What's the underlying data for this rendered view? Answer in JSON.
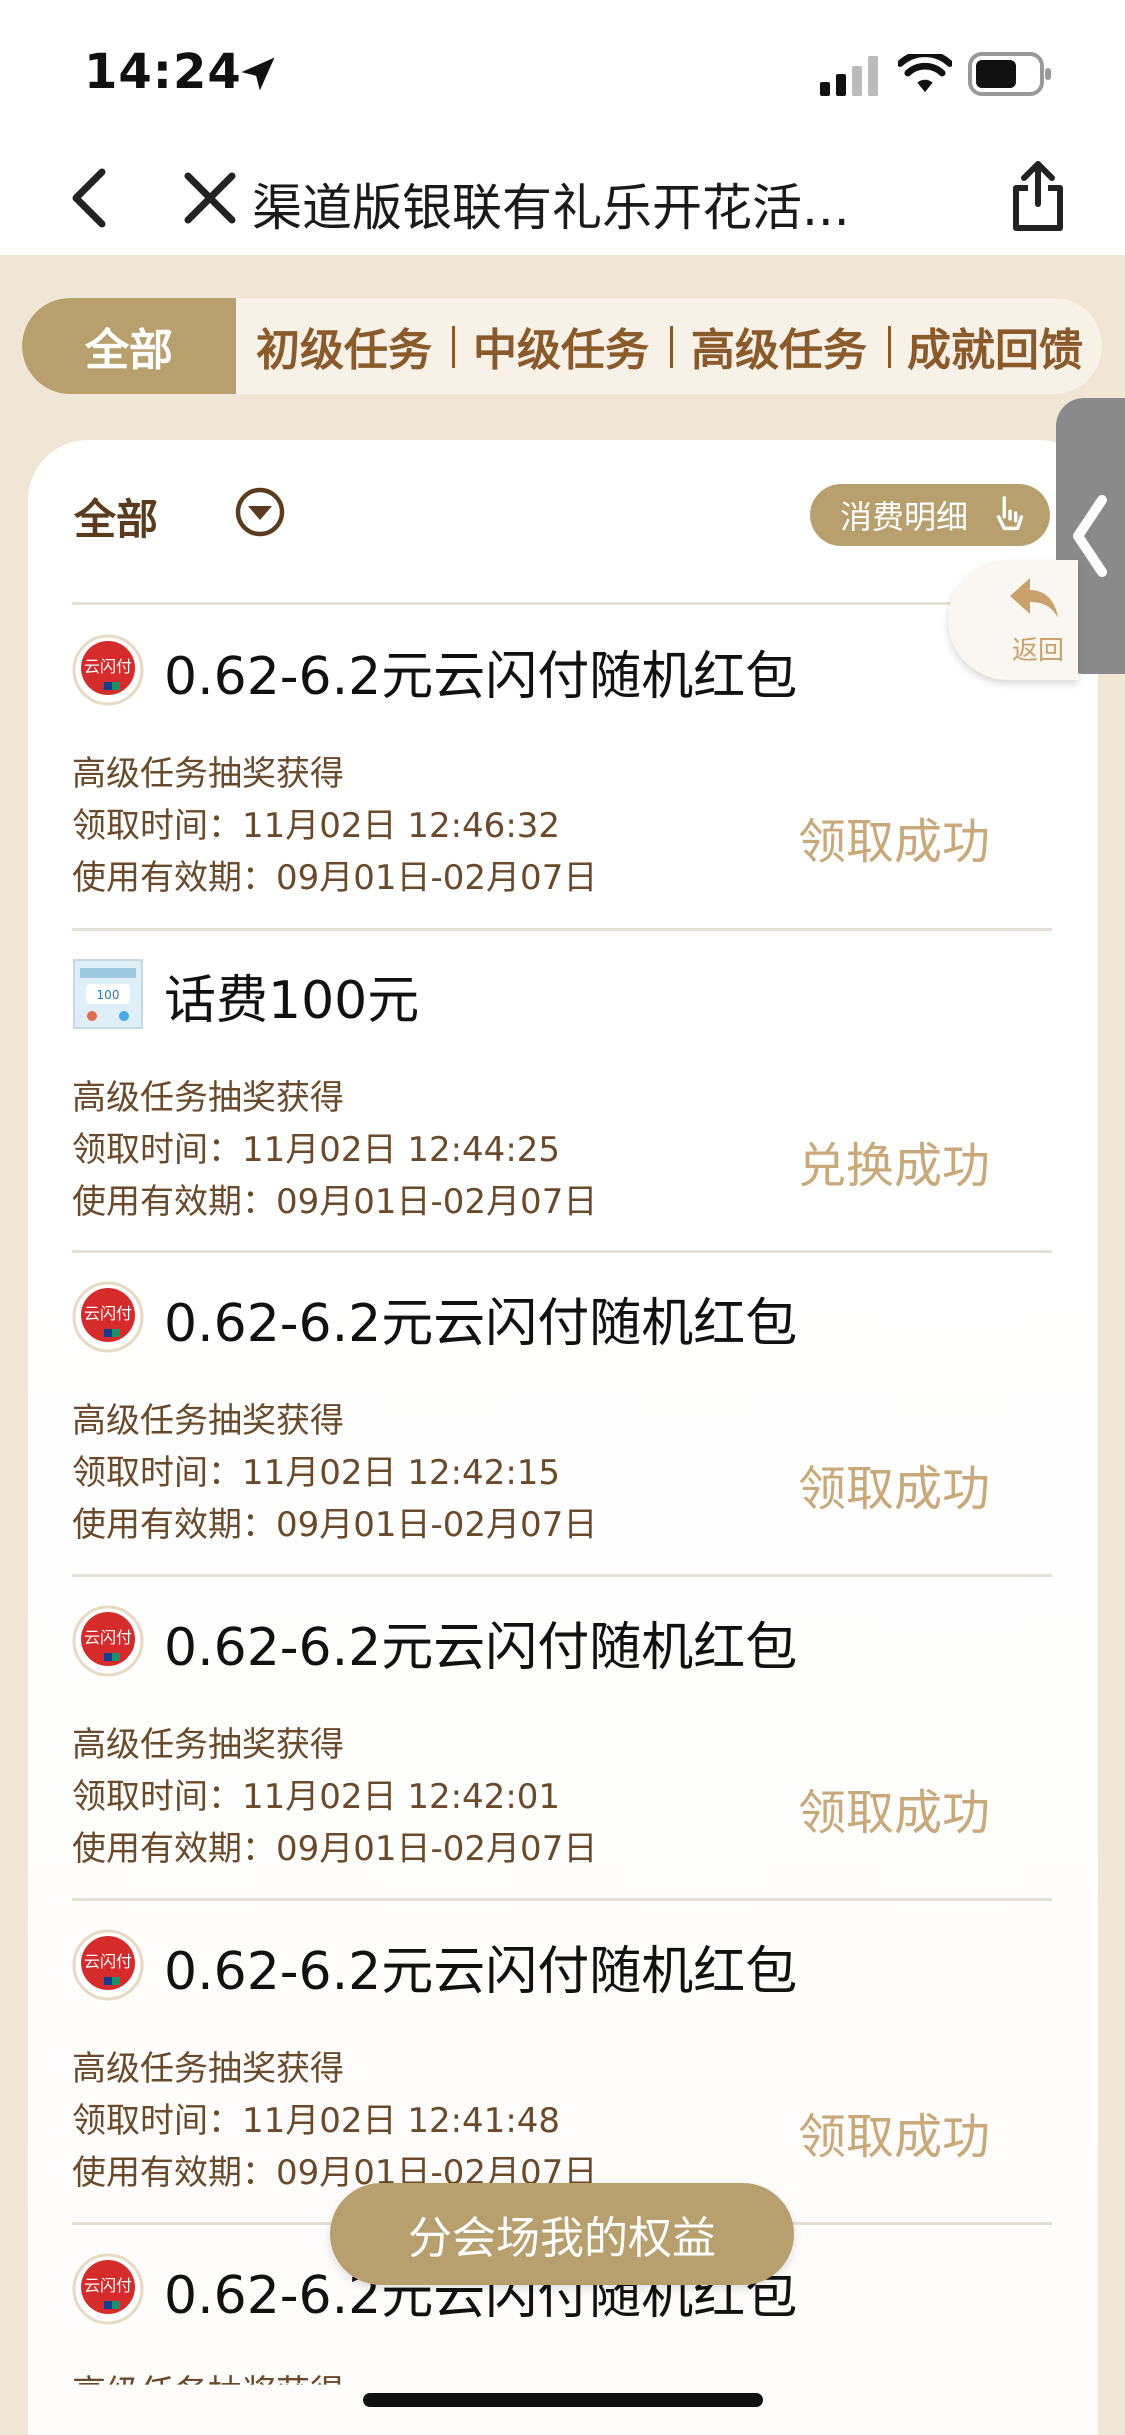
{
  "status_bar": {
    "time": "14:24"
  },
  "nav": {
    "title": "渠道版银联有礼乐开花活..."
  },
  "tabs": [
    {
      "label": "全部",
      "active": true
    },
    {
      "label": "初级任务",
      "active": false
    },
    {
      "label": "中级任务",
      "active": false
    },
    {
      "label": "高级任务",
      "active": false
    },
    {
      "label": "成就回馈",
      "active": false
    }
  ],
  "filter": {
    "label": "全部"
  },
  "detail_button": {
    "label": "消费明细"
  },
  "side": {
    "back_label": "返回"
  },
  "items": [
    {
      "title": "0.62-6.2元云闪付随机红包",
      "source": "高级任务抽奖获得",
      "time": "领取时间：11月02日 12:46:32",
      "validity": "使用有效期：09月01日-02月07日",
      "status": "领取成功",
      "icon": "unionpay-logo-icon"
    },
    {
      "title": "话费100元",
      "source": "高级任务抽奖获得",
      "time": "领取时间：11月02日 12:44:25",
      "validity": "使用有效期：09月01日-02月07日",
      "status": "兑换成功",
      "icon": "phone-credit-thumbnail-icon"
    },
    {
      "title": "0.62-6.2元云闪付随机红包",
      "source": "高级任务抽奖获得",
      "time": "领取时间：11月02日 12:42:15",
      "validity": "使用有效期：09月01日-02月07日",
      "status": "领取成功",
      "icon": "unionpay-logo-icon"
    },
    {
      "title": "0.62-6.2元云闪付随机红包",
      "source": "高级任务抽奖获得",
      "time": "领取时间：11月02日 12:42:01",
      "validity": "使用有效期：09月01日-02月07日",
      "status": "领取成功",
      "icon": "unionpay-logo-icon"
    },
    {
      "title": "0.62-6.2元云闪付随机红包",
      "source": "高级任务抽奖获得",
      "time": "领取时间：11月02日 12:41:48",
      "validity": "使用有效期：09月01日-02月07日",
      "status": "领取成功",
      "icon": "unionpay-logo-icon"
    },
    {
      "title": "0.62-6.2元云闪付随机红包",
      "source": "高级任务抽奖获得",
      "time": "",
      "validity": "",
      "status": "",
      "icon": "unionpay-logo-icon"
    }
  ],
  "float_button": {
    "label": "分会场我的权益"
  },
  "colors": {
    "accent": "#b8a06e",
    "tab_text": "#8b5a2b",
    "status_text": "#c9a87a",
    "background": "#efe6d5"
  }
}
